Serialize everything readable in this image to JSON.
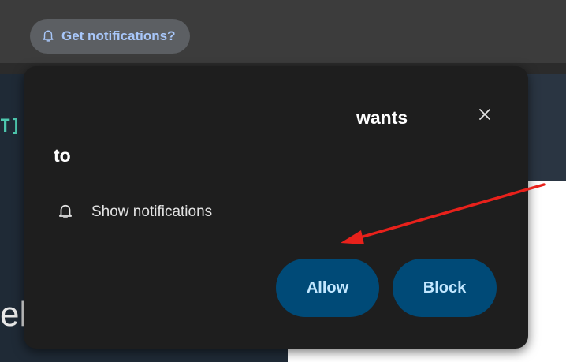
{
  "chip": {
    "icon": "bell-icon",
    "label": "Get notifications?"
  },
  "page_fragments": {
    "code_glyph": "T]",
    "heading_glyph": "el"
  },
  "popup": {
    "title_part1": "wants",
    "title_part2": "to",
    "close_icon": "close-icon",
    "permission": {
      "icon": "bell-icon",
      "label": "Show notifications"
    },
    "allow_label": "Allow",
    "block_label": "Block"
  },
  "annotation": {
    "color": "#e8211b"
  },
  "colors": {
    "chrome_bar": "#3c3c3c",
    "popup_bg": "#1e1e1e",
    "button_bg": "#004a77",
    "button_text": "#c2e7ff",
    "chip_text": "#a8c7fa"
  }
}
